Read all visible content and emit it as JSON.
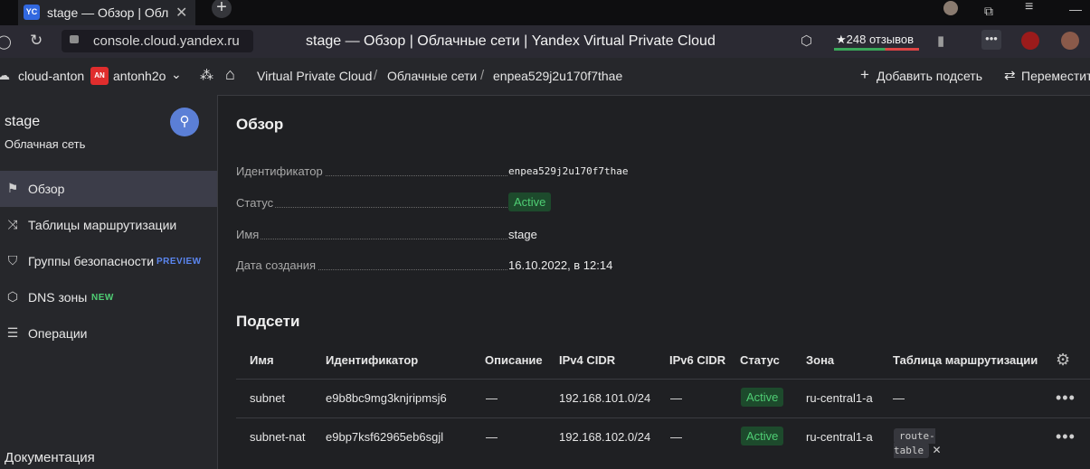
{
  "browser": {
    "tab_title": "stage — Обзор | Облачные сети | Yandex Virtual Private Cloud",
    "favicon_text": "YC",
    "url": "console.cloud.yandex.ru",
    "page_heading": "stage — Обзор | Облачные сети | Yandex Virtual Private Cloud",
    "reviews": "★248 отзывов"
  },
  "header": {
    "cloud": "cloud-anton",
    "user_badge": "AN",
    "user": "antonh2o",
    "breadcrumbs": [
      "Virtual Private Cloud",
      "Облачные сети",
      "enpea529j2u170f7thae"
    ],
    "add_subnet": "Добавить подсеть",
    "move": "Переместить"
  },
  "sidebar": {
    "title": "stage",
    "subtitle": "Облачная сеть",
    "items": [
      {
        "label": "Обзор",
        "icon": "flag-icon"
      },
      {
        "label": "Таблицы маршрутизации",
        "icon": "shuffle-icon"
      },
      {
        "label": "Группы безопасности",
        "icon": "shield-icon",
        "badge": "PREVIEW"
      },
      {
        "label": "DNS зоны",
        "icon": "hexagon-icon",
        "badge": "NEW"
      },
      {
        "label": "Операции",
        "icon": "list-icon"
      }
    ],
    "docs": "Документация"
  },
  "overview": {
    "title": "Обзор",
    "props": [
      {
        "label": "Идентификатор",
        "value": "enpea529j2u170f7thae"
      },
      {
        "label": "Статус",
        "value": "Active"
      },
      {
        "label": "Имя",
        "value": "stage"
      },
      {
        "label": "Дата создания",
        "value": "16.10.2022, в 12:14"
      }
    ]
  },
  "subnets": {
    "title": "Подсети",
    "columns": [
      "Имя",
      "Идентификатор",
      "Описание",
      "IPv4 CIDR",
      "IPv6 CIDR",
      "Статус",
      "Зона",
      "Таблица маршрутизации"
    ],
    "rows": [
      {
        "name": "subnet",
        "id": "e9b8bc9mg3knjripmsj6",
        "description": "—",
        "ipv4": "192.168.101.0/24",
        "ipv6": "—",
        "status": "Active",
        "zone": "ru-central1-a",
        "route_table": "—"
      },
      {
        "name": "subnet-nat",
        "id": "e9bp7ksf62965eb6sgjl",
        "description": "—",
        "ipv4": "192.168.102.0/24",
        "ipv6": "—",
        "status": "Active",
        "zone": "ru-central1-a",
        "route_table": "route-table"
      }
    ]
  },
  "colors": {
    "accent": "#5b7fd6",
    "active_bg": "#1d4a2c",
    "active_text": "#4fce74",
    "preview": "#5b86f0",
    "new": "#4fce74"
  }
}
